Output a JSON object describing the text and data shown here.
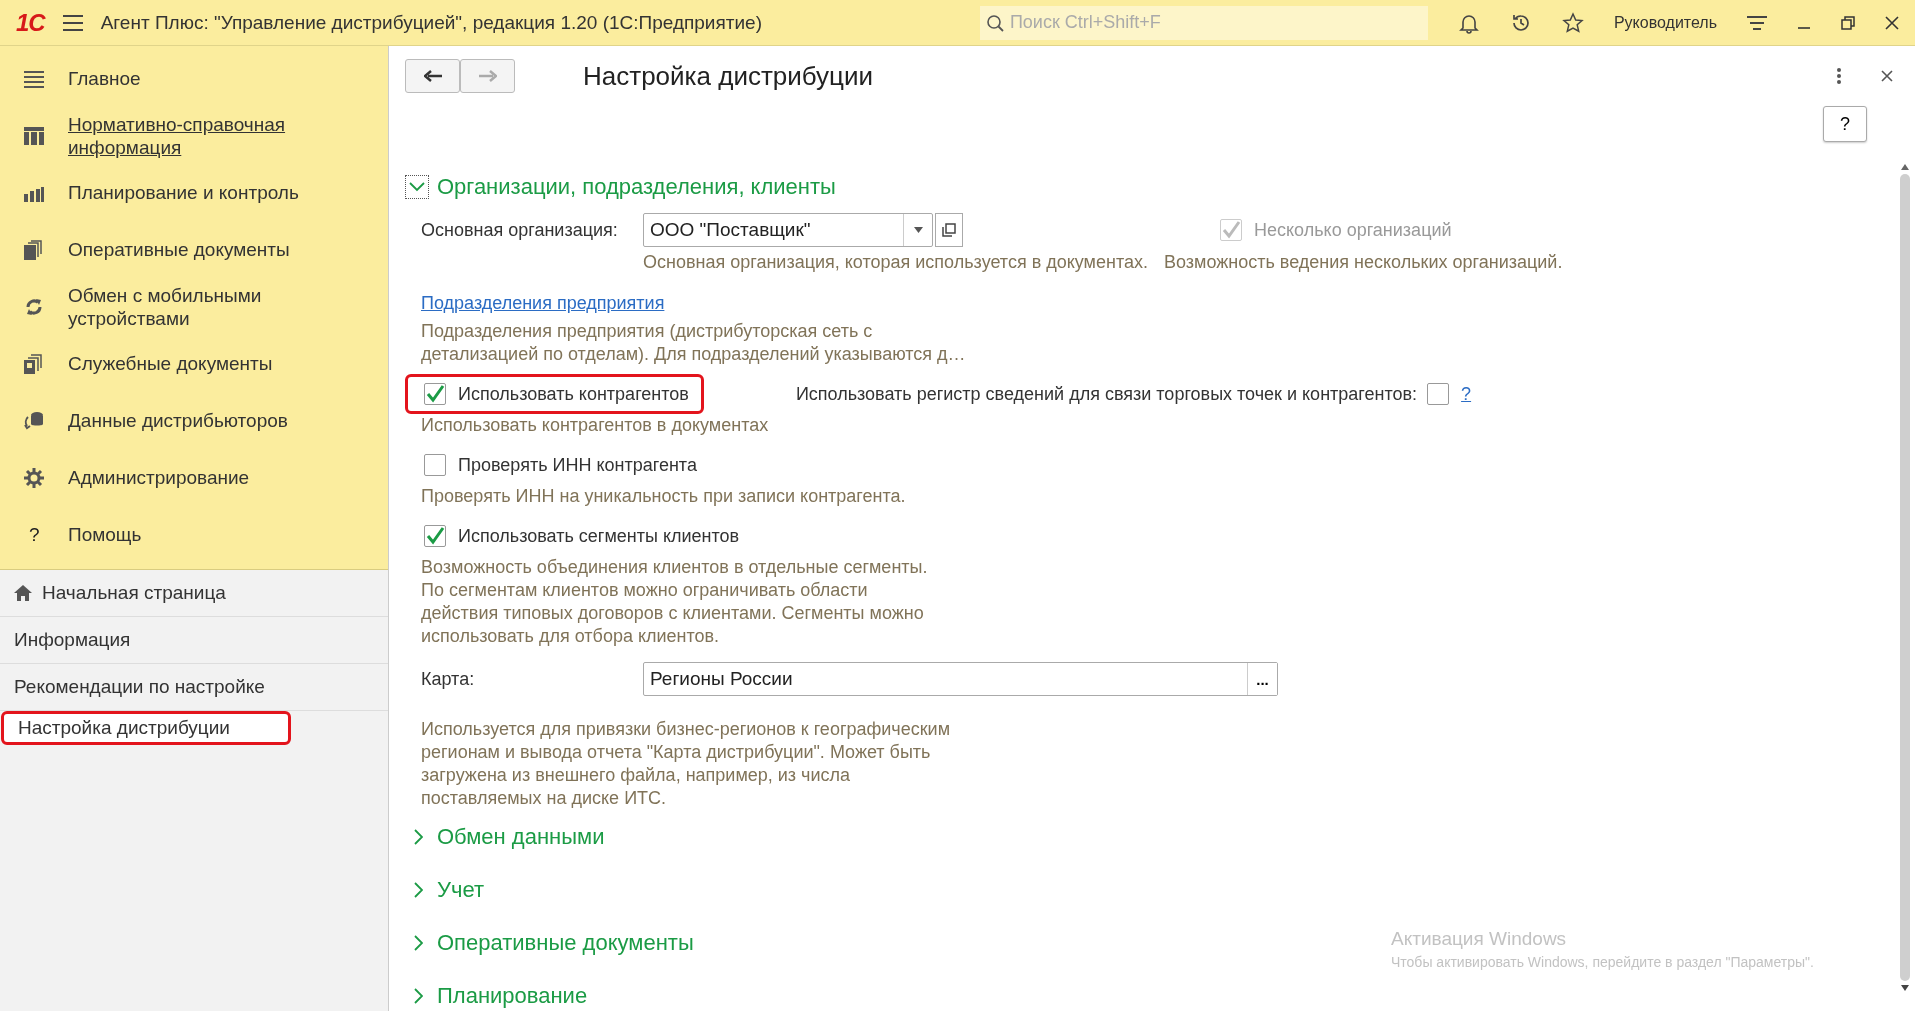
{
  "window": {
    "logo": "1С",
    "title": "Агент Плюс: \"Управление дистрибуцией\", редакция 1.20  (1С:Предприятие)",
    "user": "Руководитель"
  },
  "search": {
    "placeholder": "Поиск Ctrl+Shift+F"
  },
  "sections": [
    {
      "label": "Главное",
      "kind": "list",
      "hovered": false
    },
    {
      "label": "Нормативно-справочная информация",
      "kind": "columns",
      "hovered": true
    },
    {
      "label": "Планирование и контроль",
      "kind": "chart",
      "hovered": false
    },
    {
      "label": "Оперативные документы",
      "kind": "docs",
      "hovered": false
    },
    {
      "label": "Обмен с мобильными устройствами",
      "kind": "sync",
      "hovered": false
    },
    {
      "label": "Служебные документы",
      "kind": "docs2",
      "hovered": false
    },
    {
      "label": "Данные дистрибьюторов",
      "kind": "data",
      "hovered": false
    },
    {
      "label": "Администрирование",
      "kind": "gear",
      "hovered": false
    },
    {
      "label": "Помощь",
      "kind": "glyph",
      "glyph": "?",
      "hovered": false
    }
  ],
  "open_pages": [
    {
      "label": "Начальная страница",
      "home": true,
      "selected": false,
      "highlighted": false
    },
    {
      "label": "Информация",
      "home": false,
      "selected": false,
      "highlighted": false
    },
    {
      "label": "Рекомендации по настройке",
      "home": false,
      "selected": false,
      "highlighted": false
    },
    {
      "label": "Настройка дистрибуции",
      "home": false,
      "selected": true,
      "highlighted": true
    }
  ],
  "form": {
    "title": "Настройка дистрибуции",
    "back_enabled": true,
    "forward_enabled": false,
    "help": "?"
  },
  "group": {
    "title": "Организации, подразделения, клиенты",
    "expanded": true,
    "org": {
      "label": "Основная организация:",
      "value": "ООО \"Поставщик\"",
      "hint": "Основная организация, которая используется в документах."
    },
    "multi_org": {
      "label": "Несколько организаций",
      "checked": true,
      "disabled": true,
      "hint": "Возможность ведения нескольких организаций."
    },
    "divisions": {
      "link": "Подразделения предприятия",
      "hint_lines": [
        "Подразделения предприятия (дистрибуторская сеть с",
        "детализацией по отделам). Для подразделений указываются д…"
      ]
    },
    "options": [
      {
        "label": "Использовать контрагентов",
        "checked": true,
        "highlighted": true,
        "hint_lines": [
          "Использовать контрагентов в документах"
        ],
        "extra": {
          "label": "Использовать регистр сведений для связи торговых точек и контрагентов:",
          "checked": false,
          "help": "?"
        }
      },
      {
        "label": "Проверять ИНН контрагента",
        "checked": false,
        "highlighted": false,
        "hint_lines": [
          "Проверять ИНН на уникальность при записи контрагента."
        ]
      },
      {
        "label": "Использовать сегменты клиентов",
        "checked": true,
        "highlighted": false,
        "hint_lines": [
          "Возможность объединения клиентов в отдельные сегменты.",
          "По сегментам клиентов можно ограничивать области",
          "действия типовых договоров с клиентами. Сегменты можно",
          "использовать для отбора клиентов."
        ]
      }
    ],
    "map": {
      "label": "Карта:",
      "value": "Регионы России",
      "button": "...",
      "hint_lines": [
        "Используется для привязки бизнес-регионов к географическим",
        "регионам и вывода отчета \"Карта дистрибуции\". Может быть",
        "загружена из внешнего файла, например, из числа",
        "поставляемых на диске ИТС."
      ]
    }
  },
  "collapsed_groups": [
    {
      "title": "Обмен данными",
      "expanded": false
    },
    {
      "title": "Учет",
      "expanded": false
    },
    {
      "title": "Оперативные документы",
      "expanded": false
    },
    {
      "title": "Планирование",
      "expanded": false
    }
  ],
  "os_notice": {
    "title": "Активация Windows",
    "text": "Чтобы активировать Windows, перейдите в раздел \"Параметры\"."
  }
}
